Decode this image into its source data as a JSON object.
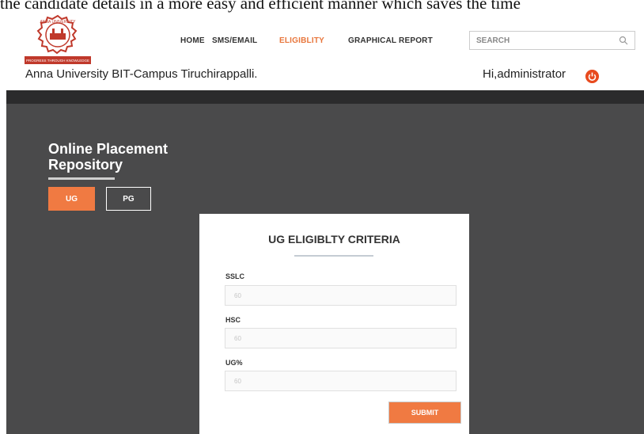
{
  "background_text": "the candidate details in a more easy and efficient manner which saves the time",
  "logo": {
    "arc_text": "ANNA UNIVERSITY",
    "motto": "PROGRESS THROUGH KNOWLEDGE"
  },
  "nav": {
    "items": [
      "HOME",
      "SMS/EMAIL",
      "ELIGIBLITY",
      "GRAPHICAL REPORT"
    ],
    "active": "ELIGIBLITY"
  },
  "search": {
    "placeholder": "SEARCH",
    "icon": "search-icon"
  },
  "header": {
    "institute": "Anna University BIT-Campus Tiruchirappalli.",
    "greeting": "Hi,administrator",
    "power_icon": "power-icon"
  },
  "sidebar": {
    "title_line1": "Online Placement",
    "title_line2": "Repository",
    "buttons": [
      "UG",
      "PG"
    ]
  },
  "form": {
    "title": "UG ELIGIBLTY CRITERIA",
    "fields": [
      {
        "label": "SSLC",
        "placeholder": "60"
      },
      {
        "label": "HSC",
        "placeholder": "60"
      },
      {
        "label": "UG%",
        "placeholder": "60"
      }
    ],
    "submit_label": "SUBMIT"
  },
  "colors": {
    "accent": "#f07a42",
    "dark_bg": "#4a4a4b",
    "dark_band": "#2b2b2c",
    "power": "#e84b1f"
  }
}
